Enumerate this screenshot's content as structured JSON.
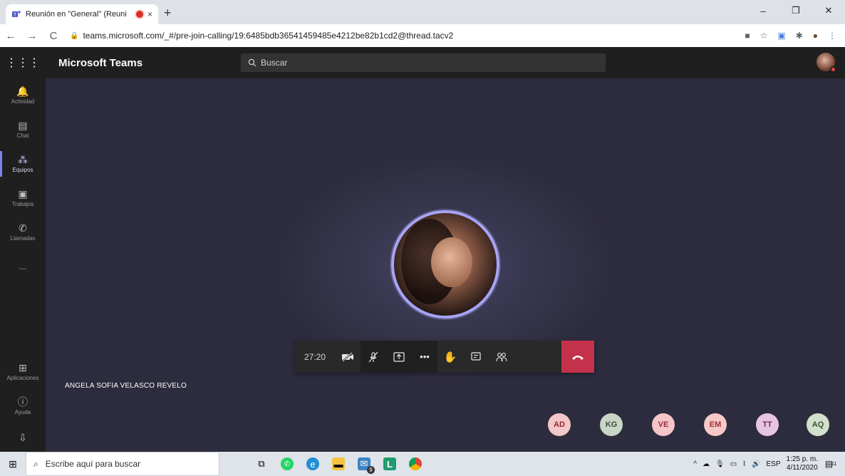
{
  "browser": {
    "tab_title": "Reunión en \"General\" (Reuni",
    "tab_close": "×",
    "new_tab": "+",
    "url": "teams.microsoft.com/_#/pre-join-calling/19:6485bdb36541459485e4212be82b1cd2@thread.tacv2",
    "window": {
      "minimize": "–",
      "restore": "❐",
      "close": "✕"
    }
  },
  "teams": {
    "brand": "Microsoft Teams",
    "search_placeholder": "Buscar",
    "rail": {
      "actividad": "Actividad",
      "chat": "Chat",
      "equipos": "Equipos",
      "trabajos": "Trabajos",
      "llamadas": "Llamadas",
      "more": "...",
      "aplicaciones": "Aplicaciones",
      "ayuda": "Ayuda"
    },
    "call": {
      "timer": "27:20",
      "caller_name": "ANGELA SOFIA VELASCO REVELO",
      "participants": [
        {
          "initials": "AD",
          "bg": "#f4c7c9",
          "fg": "#8b2a30"
        },
        {
          "initials": "KG",
          "bg": "#c9d6c5",
          "fg": "#3c4a3a"
        },
        {
          "initials": "VE",
          "bg": "#f5c5c7",
          "fg": "#9b2c35"
        },
        {
          "initials": "EM",
          "bg": "#f6c8c8",
          "fg": "#9c2f36"
        },
        {
          "initials": "TT",
          "bg": "#e7c4e4",
          "fg": "#6b2a66"
        },
        {
          "initials": "AQ",
          "bg": "#d3e0cc",
          "fg": "#3d5236"
        }
      ]
    }
  },
  "taskbar": {
    "search_placeholder": "Escribe aquí para buscar",
    "lang": "ESP",
    "time": "1:25 p. m.",
    "date": "4/11/2020",
    "mail_badge": "9",
    "notif_badge": "11"
  },
  "colors": {
    "stage_bg": "#2d2c3e",
    "accent": "#7b83eb",
    "hangup": "#c4314b"
  }
}
